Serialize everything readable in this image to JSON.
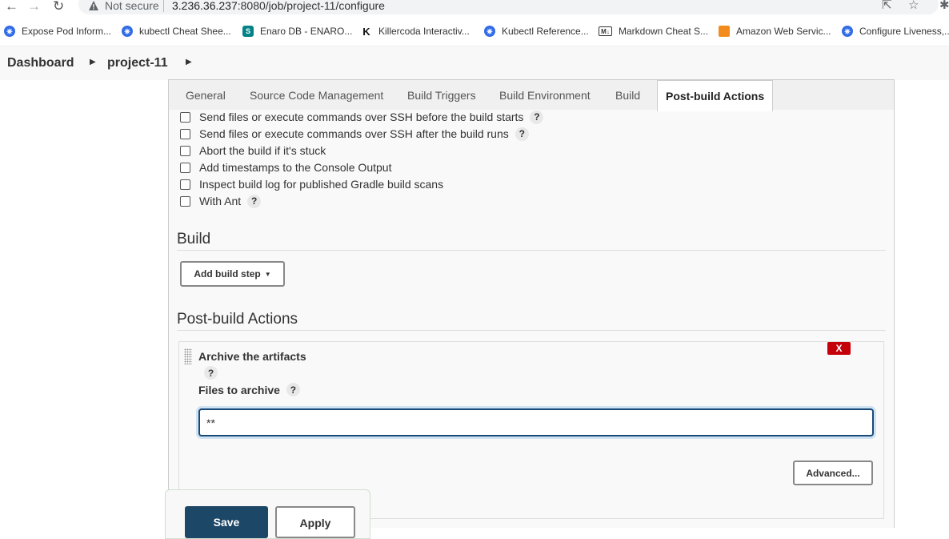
{
  "browser": {
    "security_label": "Not secure",
    "url_host": "3.236.36.237",
    "url_rest": ":8080/job/project-11/configure",
    "bookmarks": [
      {
        "label": "Expose Pod Inform...",
        "icon": "kubernetes-icon"
      },
      {
        "label": "kubectl Cheat Shee...",
        "icon": "kubernetes-icon"
      },
      {
        "label": "Enaro DB - ENARO...",
        "icon": "sharepoint-icon"
      },
      {
        "label": "Killercoda Interactiv...",
        "icon": "killercoda-icon"
      },
      {
        "label": "Kubectl Reference...",
        "icon": "kubernetes-icon"
      },
      {
        "label": "Markdown Cheat S...",
        "icon": "markdown-icon"
      },
      {
        "label": "Amazon Web Servic...",
        "icon": "aws-icon"
      },
      {
        "label": "Configure Liveness,...",
        "icon": "kubernetes-icon"
      }
    ]
  },
  "breadcrumb": {
    "items": [
      "Dashboard",
      "project-11"
    ]
  },
  "tabs": [
    "General",
    "Source Code Management",
    "Build Triggers",
    "Build Environment",
    "Build",
    "Post-build Actions"
  ],
  "active_tab": "Post-build Actions",
  "build_env_options": [
    {
      "label": "Send files or execute commands over SSH before the build starts",
      "help": "?",
      "checked": false
    },
    {
      "label": "Send files or execute commands over SSH after the build runs",
      "help": "?",
      "checked": false
    },
    {
      "label": "Abort the build if it's stuck",
      "help": "",
      "checked": false
    },
    {
      "label": "Add timestamps to the Console Output",
      "help": "",
      "checked": false
    },
    {
      "label": "Inspect build log for published Gradle build scans",
      "help": "",
      "checked": false
    },
    {
      "label": "With Ant",
      "help": "?",
      "checked": false
    }
  ],
  "build": {
    "title": "Build",
    "add_step_label": "Add build step"
  },
  "post_build": {
    "title": "Post-build Actions",
    "archive": {
      "title": "Archive the artifacts",
      "delete_label": "X",
      "help": "?",
      "files_label": "Files to archive",
      "files_value": "**",
      "advanced_label": "Advanced..."
    }
  },
  "footer": {
    "save_label": "Save",
    "apply_label": "Apply"
  },
  "colors": {
    "save_bg": "#1d4766",
    "delete_bg": "#c4000a",
    "input_border": "#1a4a7a"
  }
}
